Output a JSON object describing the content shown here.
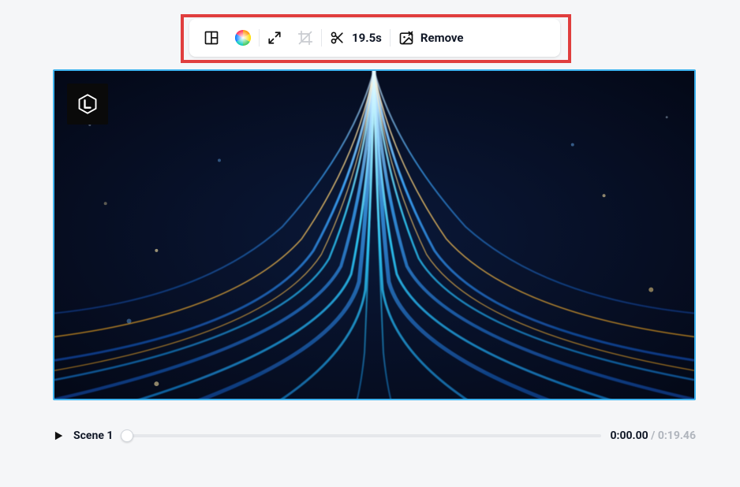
{
  "toolbar": {
    "trim_duration": "19.5s",
    "remove_label": "Remove"
  },
  "timeline": {
    "scene_label": "Scene 1",
    "time_current": "0:00.00",
    "time_separator": " / ",
    "time_total": "0:19.46"
  }
}
